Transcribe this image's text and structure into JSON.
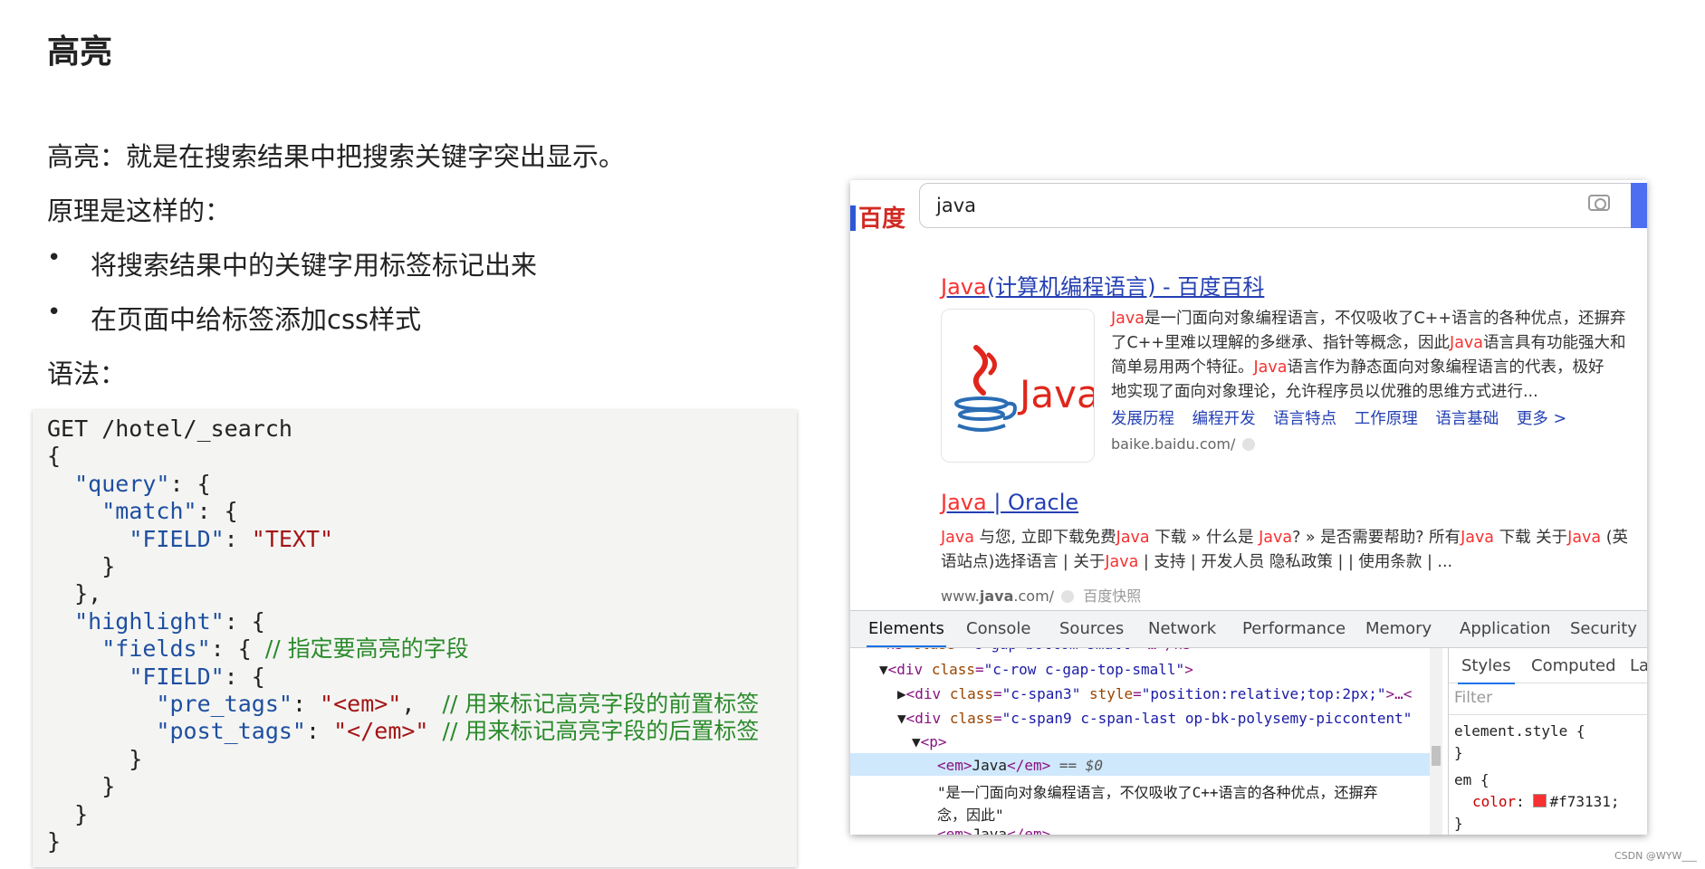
{
  "slide": {
    "title": "高亮",
    "definition": "高亮：就是在搜索结果中把搜索关键字突出显示。",
    "principle": "原理是这样的：",
    "bullets": [
      "将搜索结果中的关键字用标签标记出来",
      "在页面中给标签添加css样式"
    ],
    "syntax_label": "语法："
  },
  "code": {
    "request_line": "GET /hotel/_search",
    "comment_fields": "// 指定要高亮的字段",
    "comment_pre": "// 用来标记高亮字段的前置标签",
    "comment_post": "// 用来标记高亮字段的后置标签"
  },
  "browser": {
    "logo_text": "百度",
    "search_value": "java",
    "results": [
      {
        "title_em": "Java",
        "title_rest": "(计算机编程语言) - 百度百科",
        "body_html_lines": [
          [
            "em",
            "Java",
            "是一门面向对象编程语言，不仅吸收了C++语言的各种优点，还摒弃"
          ],
          [
            "",
            "",
            "了C++里难以理解的多继承、指针等概念，因此"
          ],
          [
            "",
            "",
            "简单易用两个特征。"
          ],
          [
            "",
            "",
            "地实现了面向对象理论，允许程序员以优雅的思维方式进行..."
          ]
        ],
        "body_line2_em": "Java",
        "body_line2_rest": "语言具有功能强大和",
        "body_line3_em": "Java",
        "body_line3_rest": "语言作为静态面向对象编程语言的代表，极好",
        "thumb_text": "Java",
        "sub_links": [
          "发展历程",
          "编程开发",
          "语言特点",
          "工作原理",
          "语言基础",
          "更多 >"
        ],
        "url": "baike.baidu.com/"
      },
      {
        "title_em": "Java",
        "title_rest": " | Oracle",
        "line1": [
          {
            "em": true,
            "t": "Java"
          },
          {
            "em": false,
            "t": " 与您, 立即下载免费"
          },
          {
            "em": true,
            "t": "Java"
          },
          {
            "em": false,
            "t": " 下载 » 什么是 "
          },
          {
            "em": true,
            "t": "Java"
          },
          {
            "em": false,
            "t": "? » 是否需要帮助? 所有"
          },
          {
            "em": true,
            "t": "Java"
          },
          {
            "em": false,
            "t": " 下载 关于"
          },
          {
            "em": true,
            "t": "Java"
          },
          {
            "em": false,
            "t": " (英"
          }
        ],
        "line2": [
          {
            "em": false,
            "t": "语站点)选择语言 | 关于"
          },
          {
            "em": true,
            "t": "Java"
          },
          {
            "em": false,
            "t": " | 支持 | 开发人员 隐私政策 | | 使用条款 | ..."
          }
        ],
        "url_prefix": "www.",
        "url_bold": "java",
        "url_suffix": ".com/",
        "snapshot": "百度快照"
      }
    ]
  },
  "devtools": {
    "tabs": [
      "Elements",
      "Console",
      "Sources",
      "Network",
      "Performance",
      "Memory",
      "Application",
      "Security"
    ],
    "active_tab": "Elements",
    "style_tabs": [
      "Styles",
      "Computed",
      "La"
    ],
    "filter_placeholder": "Filter",
    "element_style": "element.style {",
    "close_brace": "}",
    "em_rule": "em {",
    "color_prop": "color",
    "color_value": "#f73131;",
    "selected_suffix": "== $0",
    "text_node_1": "\"是一门面向对象编程语言，不仅吸收了C++语言的各种优点，还摒弃",
    "text_node_2": "念，因此\""
  },
  "watermark": "CSDN @WYW___"
}
